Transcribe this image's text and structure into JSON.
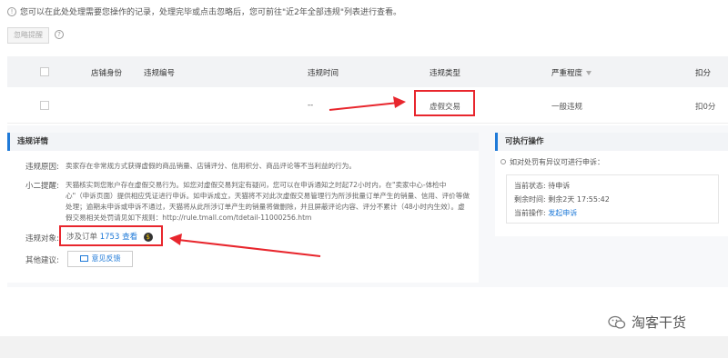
{
  "notice": {
    "icon": "info-circle-icon",
    "text": "您可以在此处处理需要您操作的记录，处理完毕或点击忽略后，您可前往\"近2年全部违规\"列表进行查看。"
  },
  "toolbar": {
    "ignore_label": "忽略提醒",
    "help_icon": "question-circle-icon"
  },
  "table": {
    "headers": {
      "shop_id": "店铺身份",
      "violation_no": "违规编号",
      "time": "违规时间",
      "type": "违规类型",
      "severity": "严重程度",
      "deduction": "扣分"
    },
    "row": {
      "shop_id": "",
      "violation_no": "",
      "time": "--",
      "type": "虚假交易",
      "severity": "一般违规",
      "deduction": "扣0分"
    }
  },
  "details": {
    "title": "违规详情",
    "reason_label": "违规原因:",
    "reason_text": "卖家存在非常规方式获得虚假的商品销量、店铺评分、信用积分、商品评论等不当利益的行为。",
    "reminder_label": "小二提醒:",
    "reminder_text": "天猫核实到您账户存在虚假交易行为。如您对虚假交易判定有疑问，您可以在申诉通知之时起72小时内，在\"卖家中心-体检中心\"（申诉页面）提供相应凭证进行申诉。如申诉成立，天猫将不对此次虚假交易管理行为所涉批量订单产生的销量、信用、评价等做处理；逾期未申诉或申诉不通过，天猫将从此所涉订单产生的销量将做删除，并且屏蔽评论内容、评分不累计（48小时内生效）。虚假交易相关处罚请见如下规则：http://rule.tmall.com/tdetail-11000256.htm",
    "object_label": "违规对象:",
    "object_prefix": "涉及订单",
    "object_count": "1753",
    "object_view": "查看",
    "suggest_label": "其他建议:",
    "feedback_label": "意见反馈"
  },
  "actions": {
    "title": "可执行操作",
    "hint": "如对处罚有异议可进行申诉：",
    "status_label": "当前状态:",
    "status_value": "待申诉",
    "remain_label": "剩余时间:",
    "remain_value": "剩余2天 17:55:42",
    "op_label": "当前操作:",
    "op_value": "发起申诉"
  },
  "watermark": {
    "text": "淘客干货",
    "icon": "wechat-icon"
  },
  "colors": {
    "accent": "#1f7ad8",
    "highlight": "#e8262d"
  }
}
